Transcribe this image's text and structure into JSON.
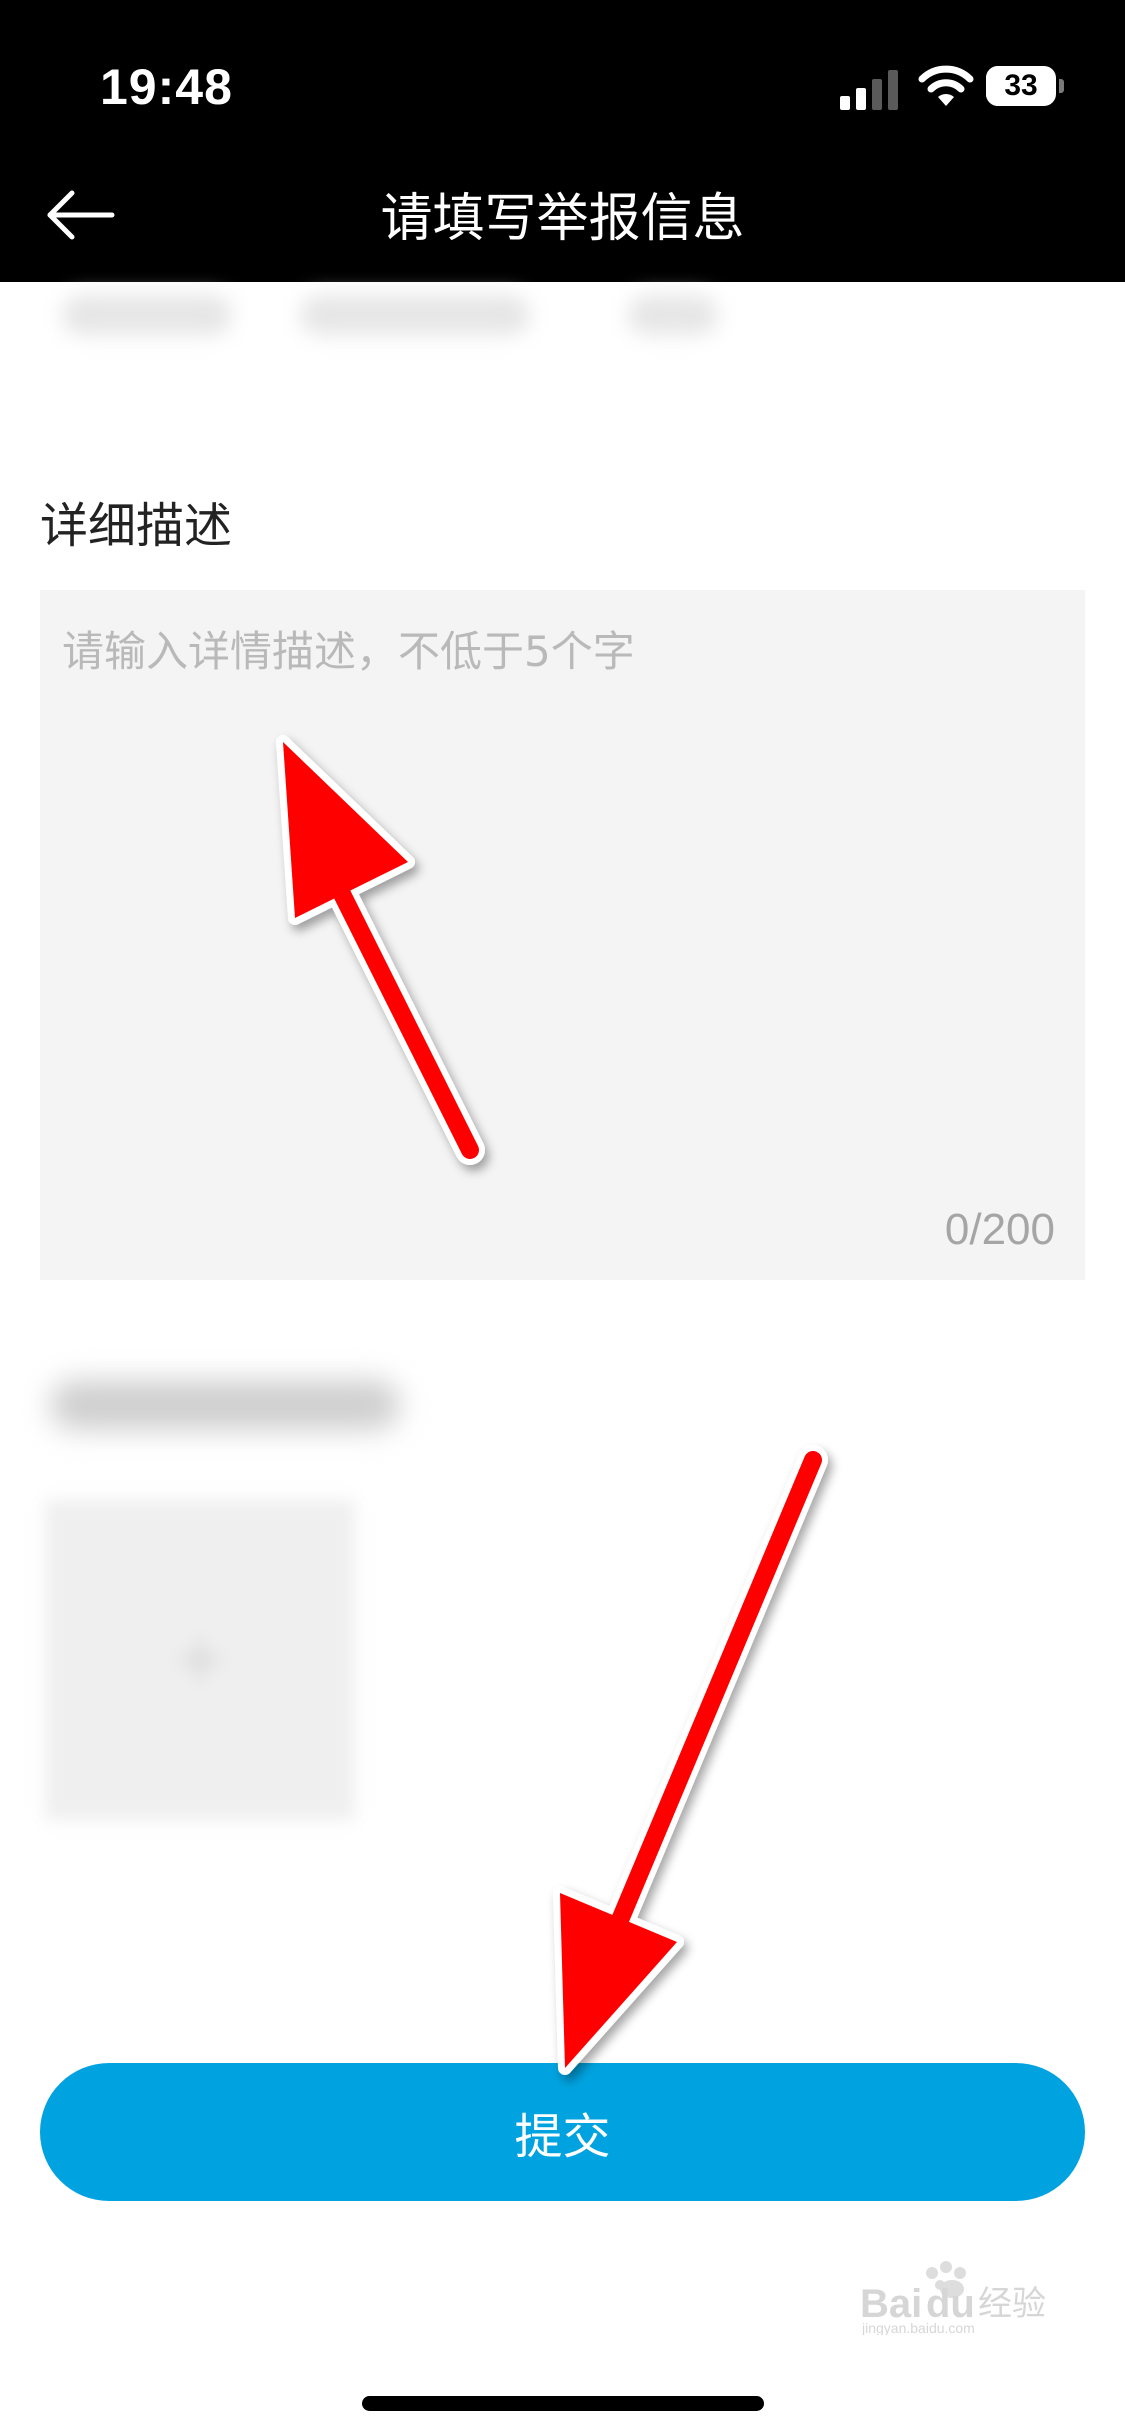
{
  "status_bar": {
    "time": "19:48",
    "battery_level": "33",
    "signal_icon": "cellular-signal-icon",
    "wifi_icon": "wifi-icon"
  },
  "nav": {
    "back_icon": "back-arrow-icon",
    "title": "请填写举报信息"
  },
  "description": {
    "label": "详细描述",
    "placeholder": "请输入详情描述，不低于5个字",
    "value": "",
    "counter": "0/200"
  },
  "upload": {
    "icon": "plus-icon"
  },
  "submit": {
    "label": "提交"
  },
  "watermark": {
    "text": "Bai经验",
    "icon": "baidu-paw-logo"
  },
  "colors": {
    "header_bg": "#000000",
    "accent": "#00a3e0",
    "field_bg": "#f4f4f4",
    "annotation_arrow": "#ff0000"
  }
}
